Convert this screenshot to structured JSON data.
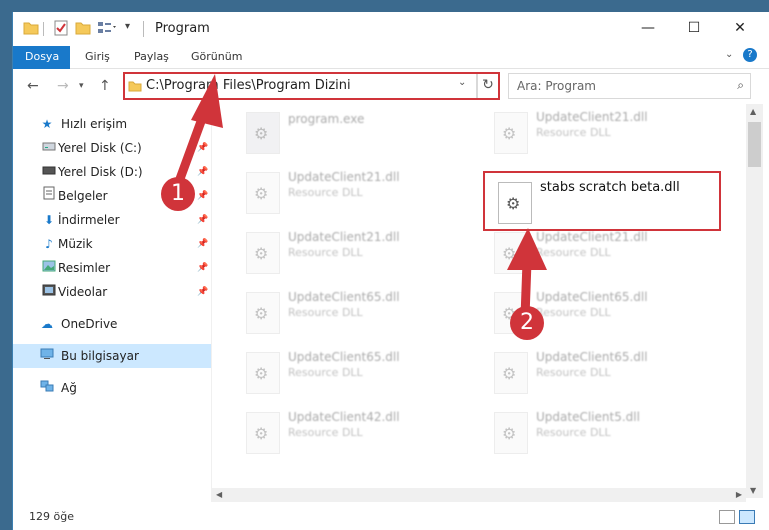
{
  "window": {
    "title": "Program",
    "buttons": {
      "minimize": "—",
      "maximize": "☐",
      "close": "✕"
    }
  },
  "ribbon": {
    "tabs": [
      "Dosya",
      "Giriş",
      "Paylaş",
      "Görünüm"
    ],
    "expand_icon": "chevron-down-icon",
    "help_label": "?"
  },
  "address": {
    "path": "C:\\Program Files\\Program Dizini",
    "refresh": "↻",
    "search_placeholder": "Ara: Program"
  },
  "nav": {
    "quick_access": "Hızlı erişim",
    "items": [
      {
        "label": "Yerel Disk (C:)",
        "icon": "drive-icon",
        "pinned": true
      },
      {
        "label": "Yerel Disk (D:)",
        "icon": "drive-icon",
        "pinned": true
      },
      {
        "label": "Belgeler",
        "icon": "documents-icon",
        "pinned": true
      },
      {
        "label": "İndirmeler",
        "icon": "downloads-icon",
        "pinned": true
      },
      {
        "label": "Müzik",
        "icon": "music-icon",
        "pinned": true
      },
      {
        "label": "Resimler",
        "icon": "pictures-icon",
        "pinned": true
      },
      {
        "label": "Videolar",
        "icon": "videos-icon",
        "pinned": true
      }
    ],
    "onedrive": "OneDrive",
    "this_pc": "Bu bilgisayar",
    "network": "Ağ"
  },
  "files": {
    "left": [
      {
        "name": "program.exe",
        "type": ""
      },
      {
        "name": "UpdateClient21.dll",
        "type": "Resource DLL"
      },
      {
        "name": "UpdateClient21.dll",
        "type": "Resource DLL"
      },
      {
        "name": "UpdateClient65.dll",
        "type": "Resource DLL"
      },
      {
        "name": "UpdateClient65.dll",
        "type": "Resource DLL"
      },
      {
        "name": "UpdateClient42.dll",
        "type": "Resource DLL"
      }
    ],
    "right": [
      {
        "name": "UpdateClient21.dll",
        "type": "Resource DLL"
      },
      {
        "name": "stabs scratch beta.dll",
        "type": ""
      },
      {
        "name": "UpdateClient21.dll",
        "type": "Resource DLL"
      },
      {
        "name": "UpdateClient65.dll",
        "type": "Resource DLL"
      },
      {
        "name": "UpdateClient65.dll",
        "type": "Resource DLL"
      },
      {
        "name": "UpdateClient5.dll",
        "type": "Resource DLL"
      }
    ]
  },
  "status": {
    "count": "129 öğe"
  },
  "annotations": {
    "badge1": "1",
    "badge2": "2",
    "color": "#d0343a"
  }
}
